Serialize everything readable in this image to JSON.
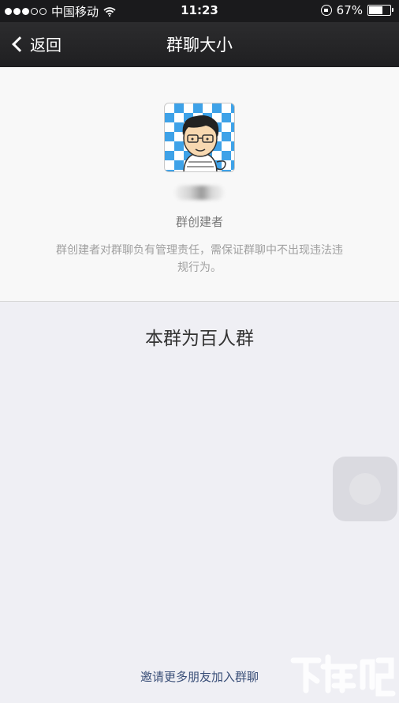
{
  "status_bar": {
    "signal_dots": [
      true,
      true,
      true,
      false,
      false
    ],
    "carrier": "中国移动",
    "time": "11:23",
    "battery_percent": "67%",
    "battery_level": 0.67
  },
  "nav": {
    "back_label": "返回",
    "title": "群聊大小"
  },
  "owner": {
    "role": "群创建者",
    "description": "群创建者对群聊负有管理责任，需保证群聊中不出现违法违规行为。"
  },
  "group_size_text": "本群为百人群",
  "invite_label": "邀请更多朋友加入群聊",
  "colors": {
    "nav_background": "#1f1f21",
    "page_background": "#efeff4",
    "link": "#3a4f78",
    "avatar_pattern": "#3ea2e8"
  }
}
